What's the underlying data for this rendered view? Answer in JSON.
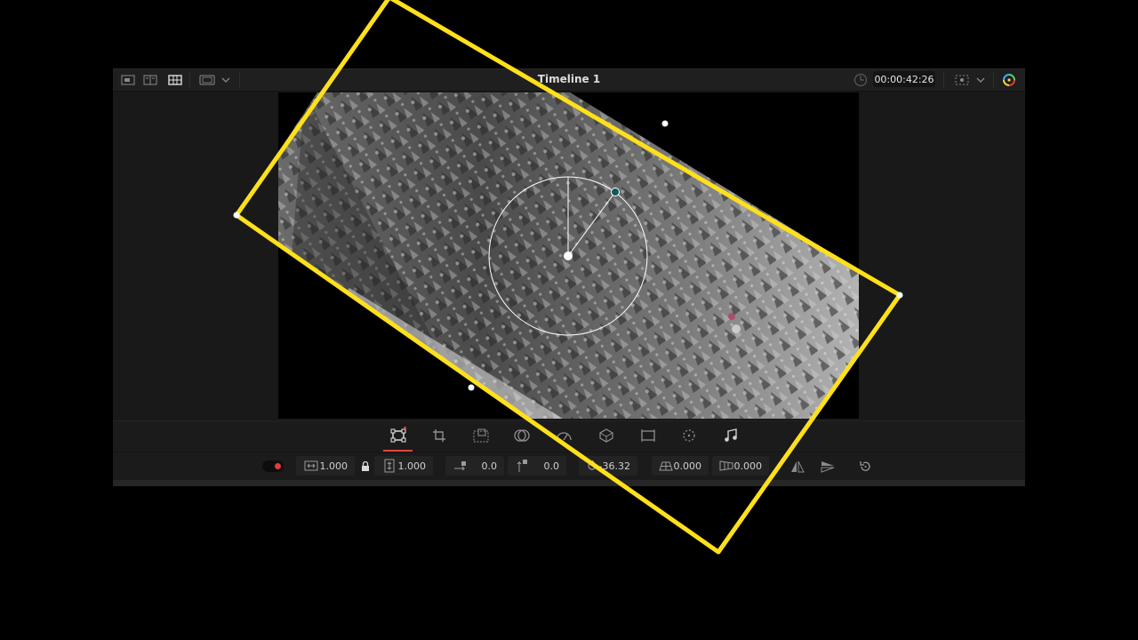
{
  "viewer": {
    "timeline_title": "Timeline 1",
    "timecode": "00:00:42:26"
  },
  "tools": [
    {
      "name": "transform",
      "active": true
    },
    {
      "name": "crop"
    },
    {
      "name": "dynamic-zoom"
    },
    {
      "name": "composite"
    },
    {
      "name": "speed"
    },
    {
      "name": "stabilization"
    },
    {
      "name": "lens-correction"
    },
    {
      "name": "retime"
    },
    {
      "name": "audio"
    }
  ],
  "params": {
    "zoom_x": "1.000",
    "zoom_y": "1.000",
    "position_x": "0.0",
    "position_y": "0.0",
    "rotation": "-36.32",
    "pitch": "0.000",
    "yaw": "0.000"
  },
  "colors": {
    "accent_red": "#e2463c",
    "highlight_yellow": "#ffe01b",
    "panel_bg": "#191919"
  }
}
